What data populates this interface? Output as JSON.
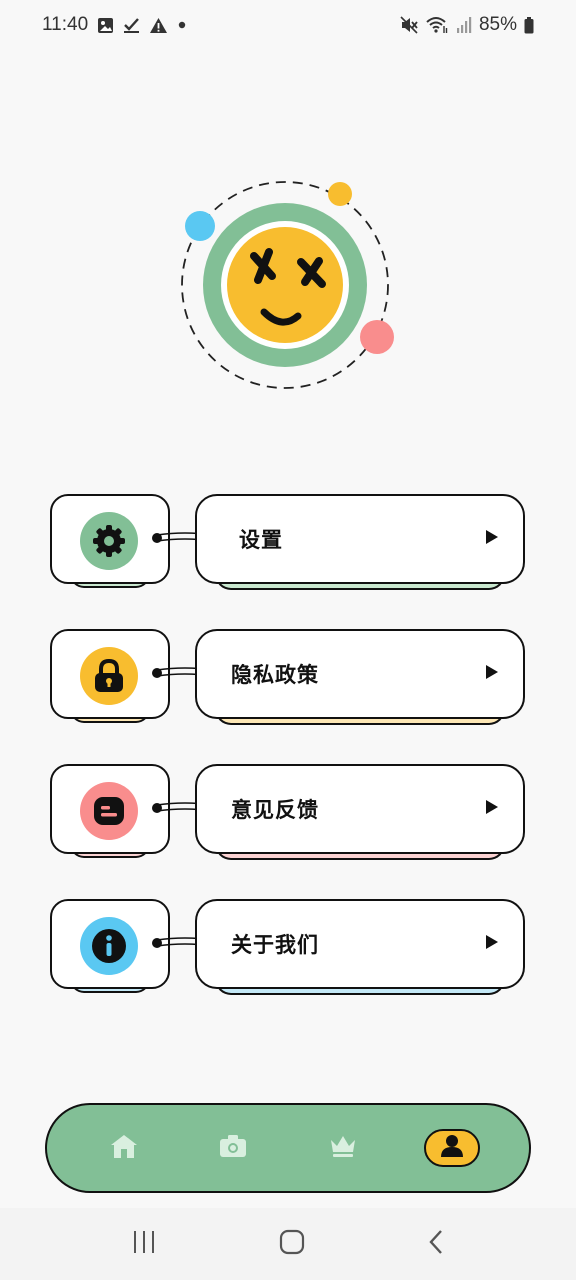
{
  "status_bar": {
    "time": "11:40",
    "battery": "85%",
    "left_icons": [
      "image-icon",
      "check-icon",
      "warning-icon",
      "dot-icon"
    ],
    "right_icons": [
      "mute-icon",
      "wifi-icon",
      "signal-icon",
      "battery-icon"
    ]
  },
  "colors": {
    "green": "#82bf96",
    "yellow": "#f8bd2f",
    "pink": "#f98d8d",
    "blue": "#5ac8f2",
    "light_green": "#c9e8cf",
    "light_yellow": "#fde7b5",
    "light_pink": "#fcd3d3",
    "light_blue": "#c4e9f7"
  },
  "menu": [
    {
      "label": "设置",
      "icon": "gear-icon",
      "accent": "#82bf96",
      "shadow": "#c9e8cf"
    },
    {
      "label": "隐私政策",
      "icon": "lock-icon",
      "accent": "#f8bd2f",
      "shadow": "#fde7b5"
    },
    {
      "label": "意见反馈",
      "icon": "feedback-icon",
      "accent": "#f98d8d",
      "shadow": "#fcd3d3"
    },
    {
      "label": "关于我们",
      "icon": "info-icon",
      "accent": "#5ac8f2",
      "shadow": "#c4e9f7"
    }
  ],
  "bottom_nav": {
    "items": [
      "home-icon",
      "camera-icon",
      "crown-icon",
      "profile-icon"
    ],
    "active": "profile-icon"
  },
  "system_nav": [
    "recents-button",
    "home-button",
    "back-button"
  ]
}
